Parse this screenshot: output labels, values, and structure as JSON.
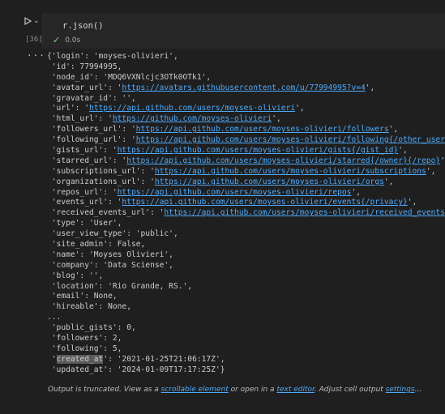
{
  "cell": {
    "execution_count": "[36]",
    "code": "r.json()",
    "duration": "0.0s"
  },
  "output": {
    "lines": [
      {
        "pre": "{'login': 'moyses-olivieri',",
        "url": "",
        "post": ""
      },
      {
        "pre": " 'id': 77994995,",
        "url": "",
        "post": ""
      },
      {
        "pre": " 'node_id': 'MDQ6VXNlcjc3OTk0OTk1',",
        "url": "",
        "post": ""
      },
      {
        "pre": " 'avatar_url': '",
        "url": "https://avatars.githubusercontent.com/u/77994995?v=4",
        "post": "',"
      },
      {
        "pre": " 'gravatar_id': '',",
        "url": "",
        "post": ""
      },
      {
        "pre": " 'url': '",
        "url": "https://api.github.com/users/moyses-olivieri",
        "post": "',"
      },
      {
        "pre": " 'html_url': '",
        "url": "https://github.com/moyses-olivieri",
        "post": "',"
      },
      {
        "pre": " 'followers_url': '",
        "url": "https://api.github.com/users/moyses-olivieri/followers",
        "post": "',"
      },
      {
        "pre": " 'following_url': '",
        "url": "https://api.github.com/users/moyses-olivieri/following{/other_user}",
        "post": "',"
      },
      {
        "pre": " 'gists_url': '",
        "url": "https://api.github.com/users/moyses-olivieri/gists{/gist_id}",
        "post": "',"
      },
      {
        "pre": " 'starred_url': '",
        "url": "https://api.github.com/users/moyses-olivieri/starred{/owner}{/repo}",
        "post": "',"
      },
      {
        "pre": " 'subscriptions_url': '",
        "url": "https://api.github.com/users/moyses-olivieri/subscriptions",
        "post": "',"
      },
      {
        "pre": " 'organizations_url': '",
        "url": "https://api.github.com/users/moyses-olivieri/orgs",
        "post": "',"
      },
      {
        "pre": " 'repos_url': '",
        "url": "https://api.github.com/users/moyses-olivieri/repos",
        "post": "',"
      },
      {
        "pre": " 'events_url': '",
        "url": "https://api.github.com/users/moyses-olivieri/events{/privacy}",
        "post": "',"
      },
      {
        "pre": " 'received_events_url': '",
        "url": "https://api.github.com/users/moyses-olivieri/received_events",
        "post": "',"
      },
      {
        "pre": " 'type': 'User',",
        "url": "",
        "post": ""
      },
      {
        "pre": " 'user_view_type': 'public',",
        "url": "",
        "post": ""
      },
      {
        "pre": " 'site_admin': False,",
        "url": "",
        "post": ""
      },
      {
        "pre": " 'name': 'Moyses Olivieri',",
        "url": "",
        "post": ""
      },
      {
        "pre": " 'company': 'Data Sciense',",
        "url": "",
        "post": ""
      },
      {
        "pre": " 'blog': '',",
        "url": "",
        "post": ""
      },
      {
        "pre": " 'location': 'Rio Grande, RS.',",
        "url": "",
        "post": ""
      },
      {
        "pre": " 'email': None,",
        "url": "",
        "post": ""
      },
      {
        "pre": " 'hireable': None,",
        "url": "",
        "post": ""
      },
      {
        "pre": "...",
        "url": "",
        "post": ""
      },
      {
        "pre": " 'public_gists': 0,",
        "url": "",
        "post": ""
      },
      {
        "pre": " 'followers': 2,",
        "url": "",
        "post": ""
      },
      {
        "pre": " 'following': 5,",
        "url": "",
        "post": ""
      },
      {
        "pre": " '",
        "hl": "created_at",
        "url": "",
        "post": "': '2021-01-25T21:06:17Z',"
      },
      {
        "pre": " 'updated_at': '2024-01-09T17:17:25Z'}",
        "url": "",
        "post": ""
      }
    ]
  },
  "note": {
    "t1": "Output is truncated. View as a ",
    "link1": "scrollable element",
    "t2": " or open in a ",
    "link2": "text editor",
    "t3": ". Adjust cell output ",
    "link3": "settings",
    "t4": "..."
  },
  "icons": {
    "run": "run-icon",
    "expand": "chevron-down-icon",
    "status": "check-icon",
    "output_menu": "more-icon"
  },
  "colors": {
    "background": "#1f1f1f",
    "link": "#4daafc",
    "success": "#89d185"
  }
}
